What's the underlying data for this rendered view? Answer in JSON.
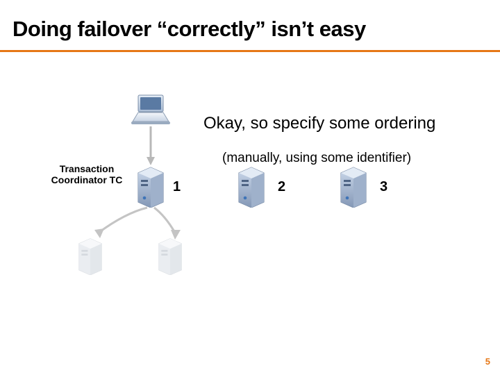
{
  "title": "Doing failover “correctly” isn’t easy",
  "line1": "Okay, so specify some ordering",
  "line2": "(manually, using some identifier)",
  "tc_label": "Transaction Coordinator TC",
  "servers": {
    "n1": "1",
    "n2": "2",
    "n3": "3"
  },
  "page_number": "5",
  "icons": {
    "laptop": "laptop-icon",
    "server": "server-icon",
    "arrow": "arrow-down-icon"
  },
  "colors": {
    "accent": "#e67817",
    "arrow": "#b8b8b8"
  }
}
